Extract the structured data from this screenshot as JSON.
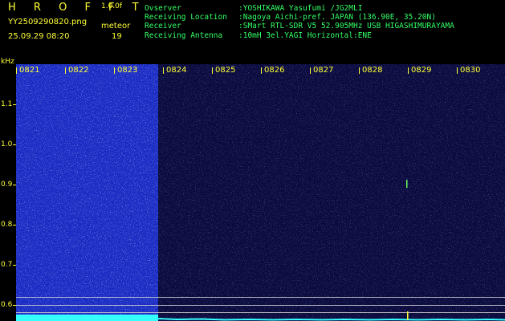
{
  "header": {
    "app_title": "H R O F F T",
    "version": "1.0.0f",
    "filename": "YY2509290820.png",
    "datetime": "25.09.29 08:20",
    "meteor_label": "meteor",
    "meteor_count": "19"
  },
  "info": [
    {
      "key": "Ovserver",
      "value": ":YOSHIKAWA Yasufumi /JG2MLI"
    },
    {
      "key": "Receiving Location",
      "value": ":Nagoya Aichi-pref. JAPAN (136.90E, 35.20N)"
    },
    {
      "key": "Receiver",
      "value": ":SMart RTL-SDR V5 52.905MHz USB HIGASHIMURAYAMA"
    },
    {
      "key": "Receiving Antenna",
      "value": ":10mH 3el.YAGI Horizontal:ENE"
    }
  ],
  "axis": {
    "unit": "kHz",
    "y_ticks": [
      "1.1",
      "1.0",
      "0.9",
      "0.8",
      "0.7",
      "0.6"
    ],
    "x_ticks": [
      "0821",
      "0822",
      "0823",
      "0824",
      "0825",
      "0826",
      "0827",
      "0828",
      "0829",
      "0830"
    ]
  },
  "colors": {
    "label": "#ffff33",
    "info_text": "#33ff66",
    "waterfall_bright": "#1a2bd6",
    "waterfall_dark": "#0d0d44",
    "signal": "#33ffff"
  }
}
